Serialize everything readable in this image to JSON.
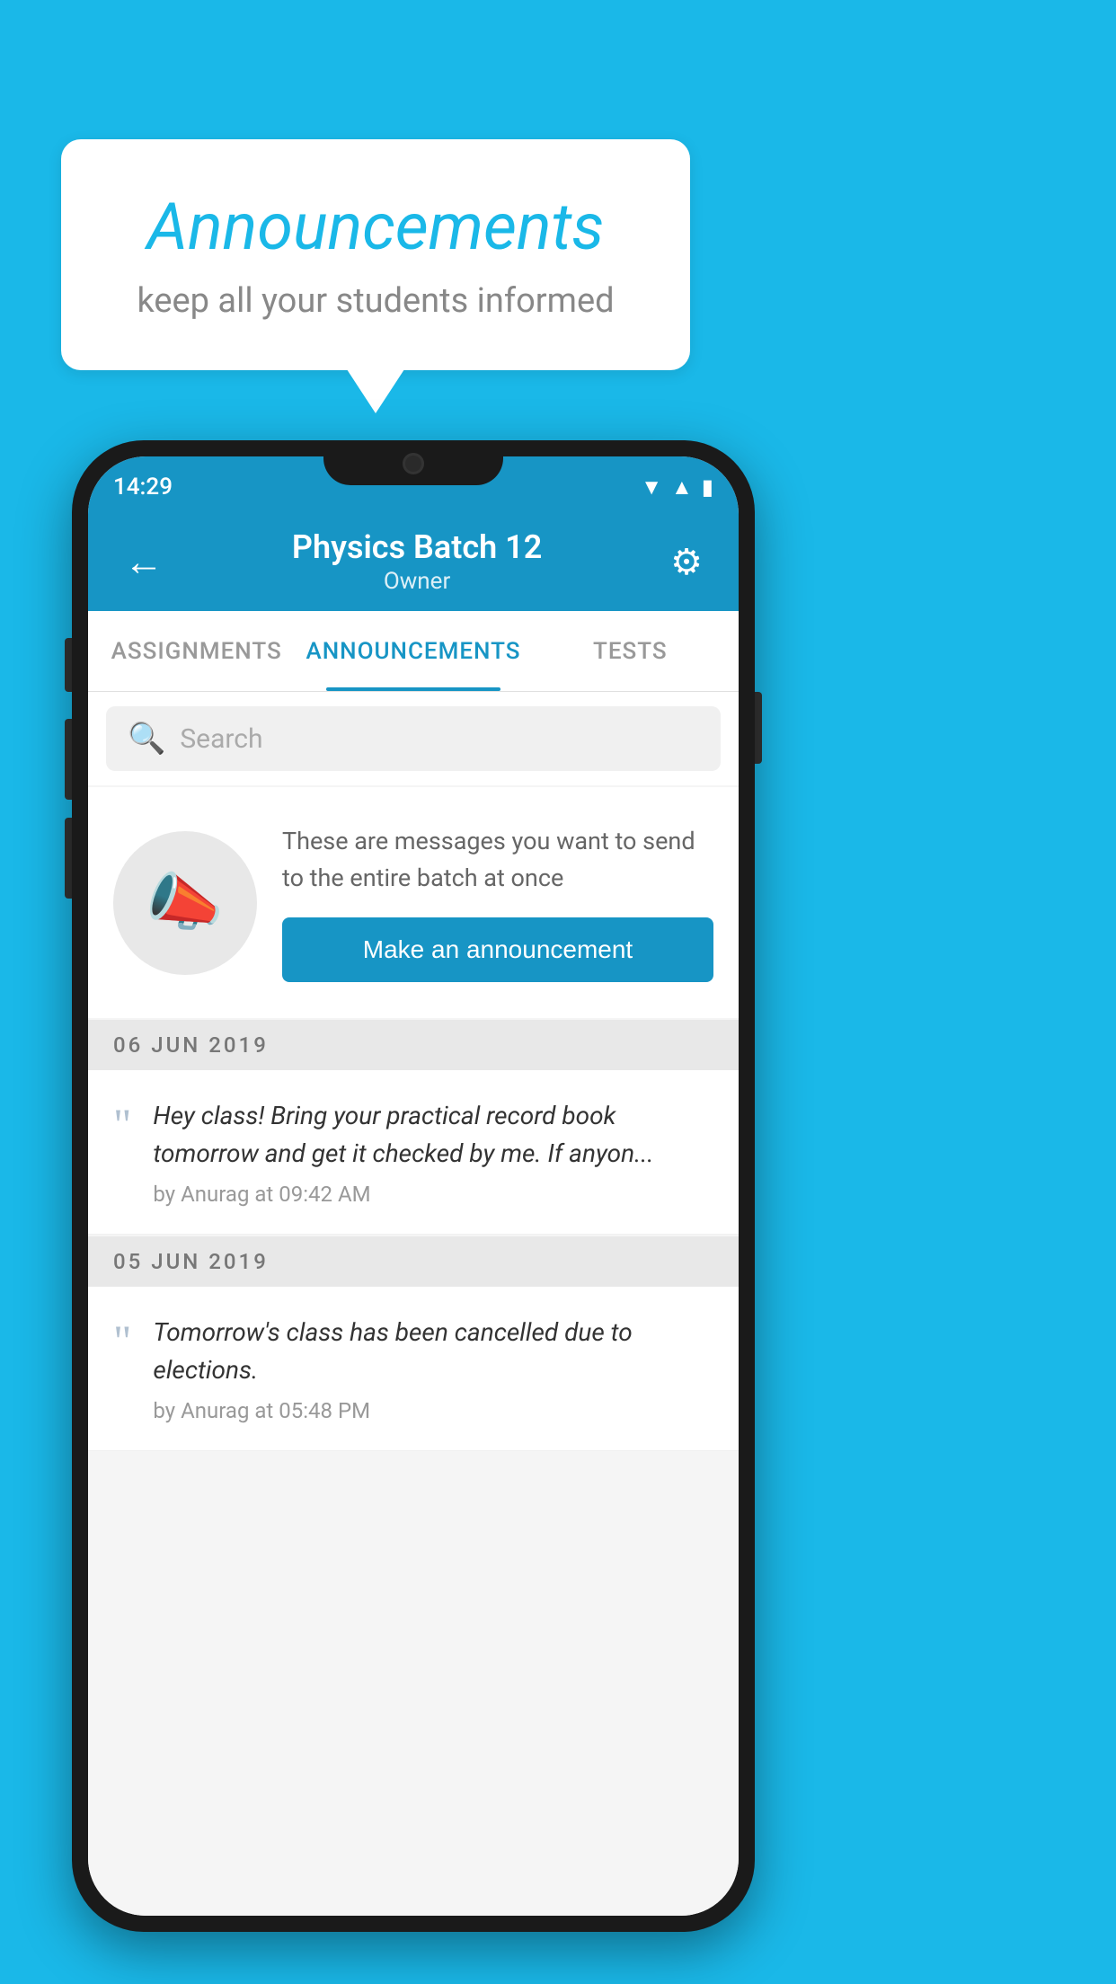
{
  "background_color": "#1ab8e8",
  "speech_bubble": {
    "title": "Announcements",
    "subtitle": "keep all your students informed"
  },
  "phone": {
    "status_bar": {
      "time": "14:29",
      "icons": [
        "wifi",
        "signal",
        "battery"
      ]
    },
    "app_bar": {
      "back_label": "←",
      "title": "Physics Batch 12",
      "subtitle": "Owner",
      "gear_label": "⚙"
    },
    "tabs": [
      {
        "label": "ASSIGNMENTS",
        "active": false
      },
      {
        "label": "ANNOUNCEMENTS",
        "active": true
      },
      {
        "label": "TESTS",
        "active": false
      }
    ],
    "search": {
      "placeholder": "Search"
    },
    "announcement_prompt": {
      "description": "These are messages you want to send to the entire batch at once",
      "button_label": "Make an announcement"
    },
    "announcements": [
      {
        "date": "06  JUN  2019",
        "message": "Hey class! Bring your practical record book tomorrow and get it checked by me. If anyon...",
        "meta": "by Anurag at 09:42 AM"
      },
      {
        "date": "05  JUN  2019",
        "message": "Tomorrow's class has been cancelled due to elections.",
        "meta": "by Anurag at 05:48 PM"
      }
    ]
  }
}
